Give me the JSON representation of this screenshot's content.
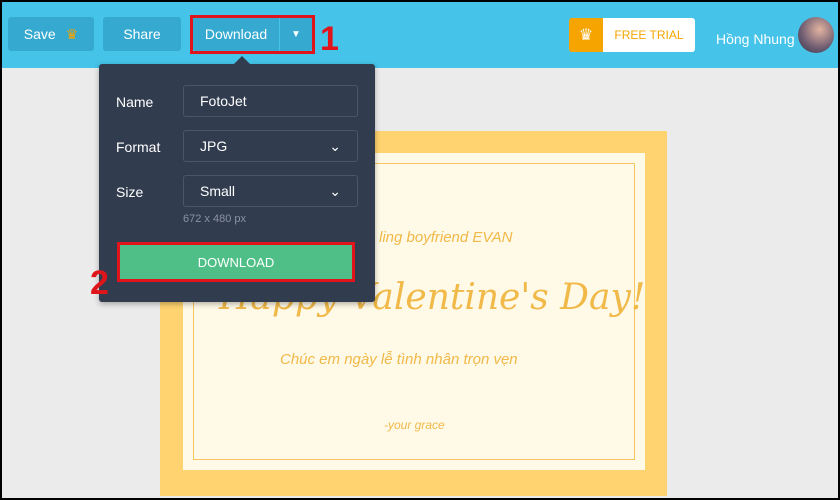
{
  "toolbar": {
    "save_label": "Save",
    "share_label": "Share",
    "download_label": "Download",
    "free_trial_label": "FREE TRIAL",
    "user_name": "Hồng Nhung"
  },
  "annotations": {
    "step1": "1",
    "step2": "2"
  },
  "download_panel": {
    "name_label": "Name",
    "name_value": "FotoJet",
    "format_label": "Format",
    "format_value": "JPG",
    "size_label": "Size",
    "size_value": "Small",
    "size_hint": "672 x 480 px",
    "download_button": "DOWNLOAD"
  },
  "card": {
    "line1": "ling boyfriend EVAN",
    "title": "Happy Valentine's Day!",
    "subtitle": "Chúc em ngày lễ tình nhân trọn vẹn",
    "signature": "-your grace"
  },
  "colors": {
    "topbar": "#45c3e8",
    "accent_green": "#4fbf87",
    "highlight_red": "#e0141b",
    "card_gold": "#ffd36f"
  },
  "icons": {
    "save": "crown-icon",
    "trial": "crown-icon",
    "dropdown": "caret-down-icon",
    "select": "chevron-down-icon"
  }
}
